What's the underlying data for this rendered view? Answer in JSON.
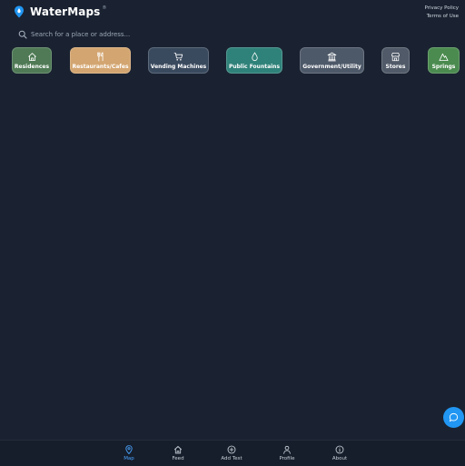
{
  "app": {
    "title": "WaterMaps",
    "superscript": "®"
  },
  "legal": {
    "privacy": "Privacy Policy",
    "terms": "Terms of Use"
  },
  "search": {
    "placeholder": "Search for a place or address..."
  },
  "categories": [
    {
      "label": "Residences",
      "icon": "home-icon",
      "color": "#4f7a55"
    },
    {
      "label": "Restaurants/Cafes",
      "icon": "utensils-icon",
      "color": "#d3a570"
    },
    {
      "label": "Vending Machines",
      "icon": "cart-icon",
      "color": "#3a4a5e"
    },
    {
      "label": "Public Fountains",
      "icon": "droplet-icon",
      "color": "#2f8279"
    },
    {
      "label": "Government/Utility",
      "icon": "building-icon",
      "color": "#4d5868"
    },
    {
      "label": "Stores",
      "icon": "store-icon",
      "color": "#505a68"
    },
    {
      "label": "Springs",
      "icon": "mountain-icon",
      "color": "#4b8b4f"
    }
  ],
  "nav": [
    {
      "label": "Map",
      "icon": "map-pin-icon",
      "active": true
    },
    {
      "label": "Feed",
      "icon": "home-icon"
    },
    {
      "label": "Add Test",
      "icon": "plus-circle-icon"
    },
    {
      "label": "Profile",
      "icon": "user-icon"
    },
    {
      "label": "About",
      "icon": "info-icon"
    }
  ],
  "colors": {
    "background": "#1a2231",
    "accent": "#2196f3",
    "nav_active": "#4aa3ff"
  }
}
